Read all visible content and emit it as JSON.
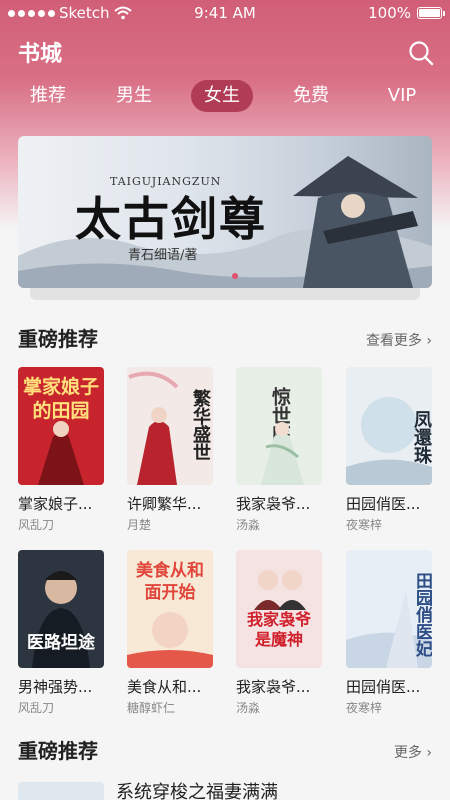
{
  "status": {
    "carrier": "Sketch",
    "time": "9:41 AM",
    "battery": "100%"
  },
  "header": {
    "title": "书城"
  },
  "tabs": [
    {
      "label": "推荐",
      "active": false
    },
    {
      "label": "男生",
      "active": false
    },
    {
      "label": "女生",
      "active": true
    },
    {
      "label": "免费",
      "active": false
    },
    {
      "label": "VIP",
      "active": false
    }
  ],
  "banner": {
    "title": "太古剑尊",
    "subtitle": "TAIGUJIANGZUN",
    "author": "青石细语/著"
  },
  "section1": {
    "title": "重磅推荐",
    "more": "查看更多 ›",
    "books": [
      {
        "title": "掌家娘子...",
        "author": "风乱刀",
        "cover_text": "掌家娘子的田园",
        "cover_color": "#c8242e"
      },
      {
        "title": "许卿繁华...",
        "author": "月楚",
        "cover_text": "繁华盛世",
        "cover_color": "#f3e9e6"
      },
      {
        "title": "我家袅爷...",
        "author": "汤淼",
        "cover_text": "惊世医妃",
        "cover_color": "#e7efe7"
      },
      {
        "title": "田园俏医...",
        "author": "夜寒梓",
        "cover_text": "凤還珠",
        "cover_color": "#e9eef2"
      },
      {
        "title": "男神强势...",
        "author": "风乱刀",
        "cover_text": "医路坦途",
        "cover_color": "#2c3540"
      },
      {
        "title": "美食从和...",
        "author": "糖醇虾仁",
        "cover_text": "美食从和面开始",
        "cover_color": "#f8e9d6"
      },
      {
        "title": "我家袅爷...",
        "author": "汤淼",
        "cover_text": "我家袅爷是魔神",
        "cover_color": "#f4e3e2"
      },
      {
        "title": "田园俏医...",
        "author": "夜寒梓",
        "cover_text": "田园俏医妃",
        "cover_color": "#e8eef6"
      }
    ]
  },
  "section2": {
    "title": "重磅推荐",
    "more": "更多 ›",
    "first_book": "系统穿梭之福妻满满"
  }
}
